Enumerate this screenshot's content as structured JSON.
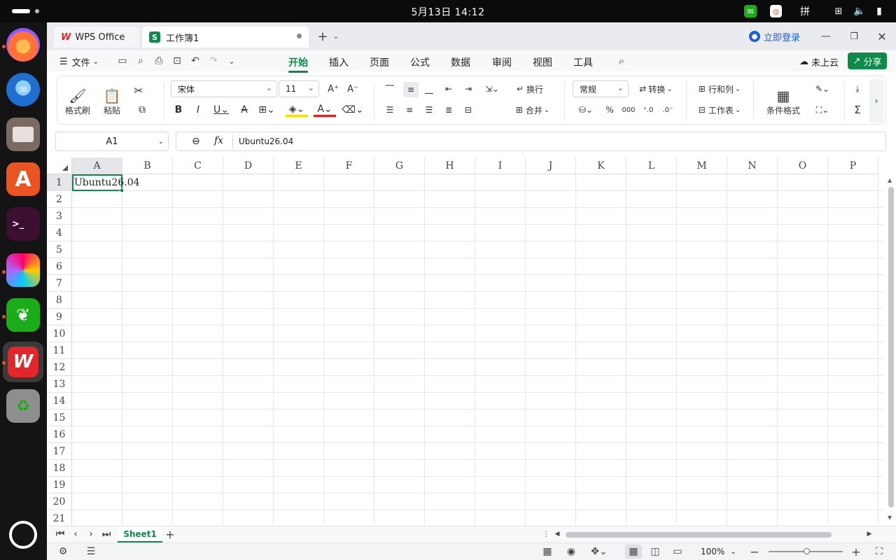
{
  "system": {
    "clock": "5月13日 14:12",
    "ime": "拼"
  },
  "tabs": [
    {
      "label": "WPS Office"
    },
    {
      "label": "工作簿1"
    }
  ],
  "window": {
    "login_label": "立即登录"
  },
  "menu": {
    "file_label": "文件",
    "items": [
      "开始",
      "插入",
      "页面",
      "公式",
      "数据",
      "审阅",
      "视图",
      "工具"
    ],
    "cloud_label": "未上云",
    "share_label": "分享"
  },
  "ribbon": {
    "format_painter": "格式刷",
    "paste": "粘贴",
    "font_name": "宋体",
    "font_size": "11",
    "wrap": "换行",
    "merge": "合并",
    "number_format": "常规",
    "convert": "转换",
    "row_col": "行和列",
    "worksheet": "工作表",
    "cond_format": "条件格式"
  },
  "formula_bar": {
    "name_box": "A1",
    "fx": "fx",
    "content": "Ubuntu26.04"
  },
  "grid": {
    "columns": [
      "A",
      "B",
      "C",
      "D",
      "E",
      "F",
      "G",
      "H",
      "I",
      "J",
      "K",
      "L",
      "M",
      "N",
      "O",
      "P"
    ],
    "rows": [
      "1",
      "2",
      "3",
      "4",
      "5",
      "6",
      "7",
      "8",
      "9",
      "10",
      "11",
      "12",
      "13",
      "14",
      "15",
      "16",
      "17",
      "18",
      "19",
      "20",
      "21"
    ],
    "cell_a1": "Ubuntu26.04"
  },
  "sheets": {
    "active": "Sheet1"
  },
  "status": {
    "zoom": "100%"
  },
  "colors": {
    "accent": "#0f8a4a",
    "wps_red": "#e3262a"
  }
}
